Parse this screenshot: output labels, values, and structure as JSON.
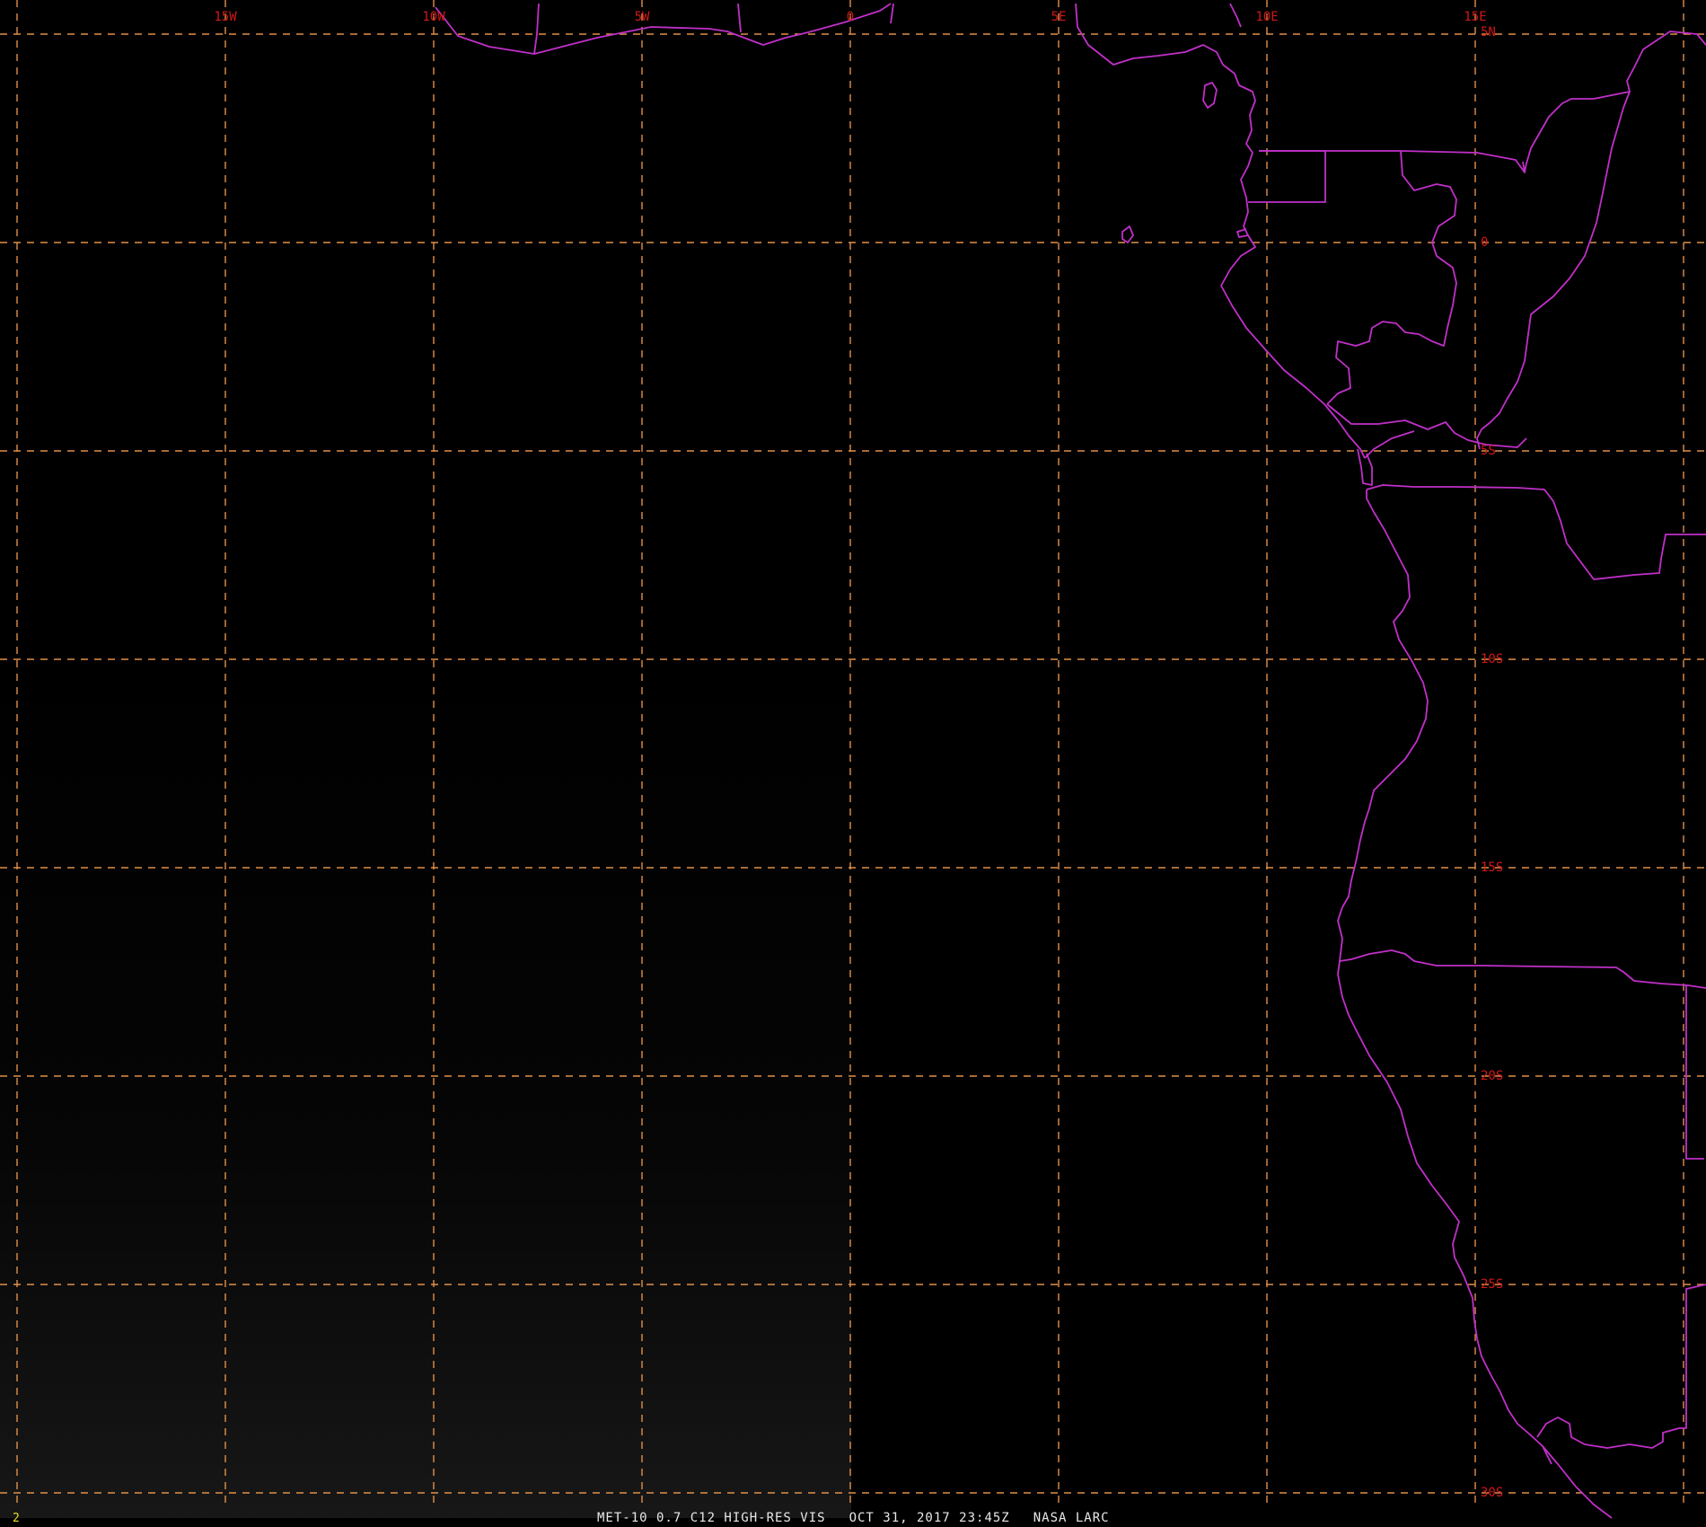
{
  "viewer": {
    "frame_number": "2",
    "caption": {
      "product": "MET-10 0.7 C12 HIGH-RES VIS",
      "datetime": "OCT 31, 2017 23:45Z",
      "source": "NASA LARC"
    }
  },
  "map": {
    "projection": "geographic",
    "lon_range": [
      -20,
      20
    ],
    "lat_range": [
      -31,
      6
    ],
    "grid": {
      "longitudes": [
        -20,
        -15,
        -10,
        -5,
        0,
        5,
        10,
        15,
        20
      ],
      "latitudes": [
        5,
        0,
        -5,
        -10,
        -15,
        -20,
        -25,
        -30
      ],
      "lon_labels": [
        {
          "lon": -15,
          "text": "15W"
        },
        {
          "lon": -10,
          "text": "10W"
        },
        {
          "lon": -5,
          "text": "5W"
        },
        {
          "lon": 0,
          "text": "0"
        },
        {
          "lon": 5,
          "text": "5E"
        },
        {
          "lon": 10,
          "text": "10E"
        },
        {
          "lon": 15,
          "text": "15E"
        }
      ],
      "lat_labels": [
        {
          "lat": 5,
          "text": "5N"
        },
        {
          "lat": 0,
          "text": "0"
        },
        {
          "lat": -5,
          "text": "5S"
        },
        {
          "lat": -10,
          "text": "10S"
        },
        {
          "lat": -15,
          "text": "15S"
        },
        {
          "lat": -20,
          "text": "20S"
        },
        {
          "lat": -25,
          "text": "25S"
        },
        {
          "lat": -30,
          "text": "30S"
        }
      ],
      "line_color": "#e0904a",
      "label_color": "#d01818"
    },
    "border_color": "#c030c8",
    "background_color": "#000000"
  }
}
